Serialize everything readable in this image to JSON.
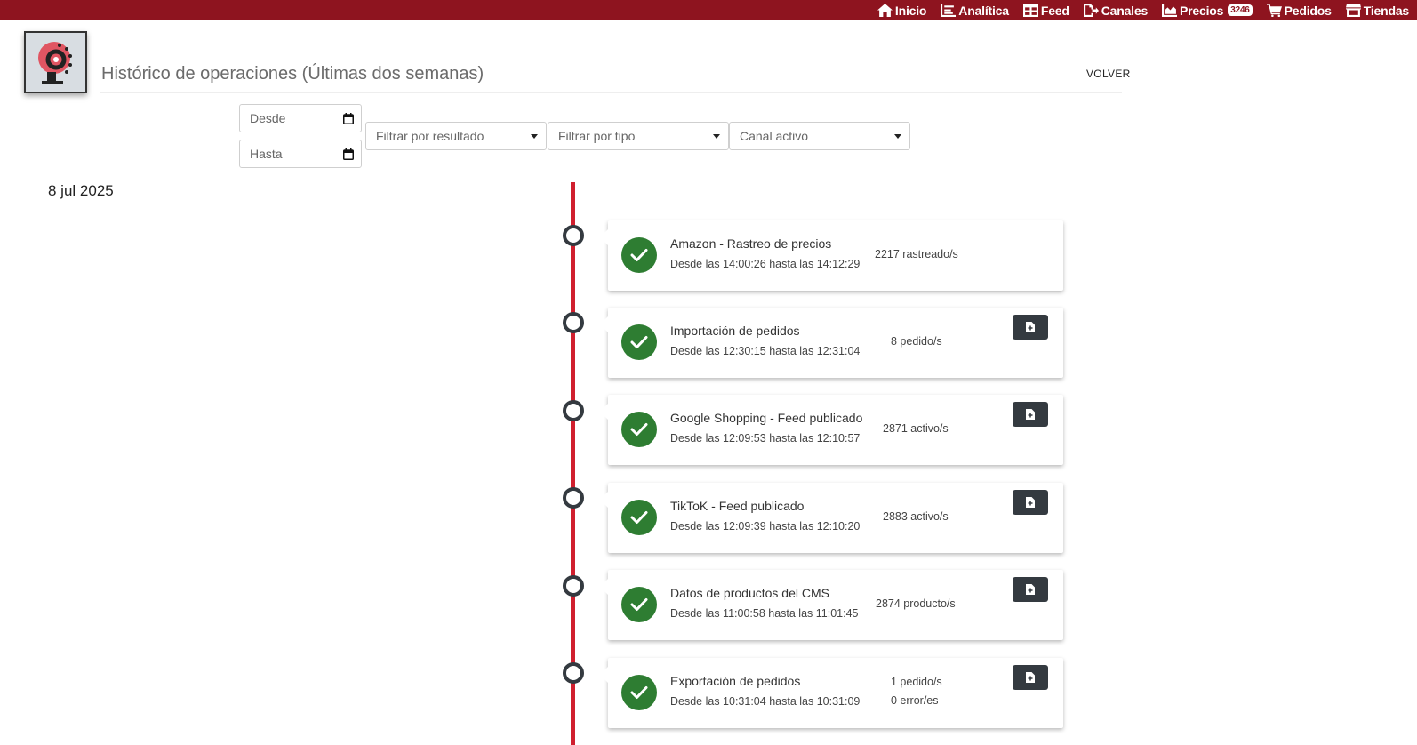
{
  "nav": {
    "items": [
      {
        "label": "Inicio",
        "icon": "home-icon"
      },
      {
        "label": "Analítica",
        "icon": "analytics-icon"
      },
      {
        "label": "Feed",
        "icon": "table-icon"
      },
      {
        "label": "Canales",
        "icon": "export-file-icon"
      },
      {
        "label": "Precios",
        "icon": "area-chart-icon",
        "badge": "3246"
      },
      {
        "label": "Pedidos",
        "icon": "cart-icon"
      },
      {
        "label": "Tiendas",
        "icon": "store-icon"
      }
    ]
  },
  "header": {
    "title": "Histórico de operaciones (Últimas dos semanas)",
    "back_label": "VOLVER"
  },
  "filters": {
    "from_placeholder": "Desde",
    "to_placeholder": "Hasta",
    "result_select": "Filtrar por resultado",
    "type_select": "Filtrar por tipo",
    "channel_select": "Canal activo"
  },
  "date_group": "8 jul 2025",
  "operations": [
    {
      "title": "Amazon - Rastreo de precios",
      "time": "Desde las 14:00:26 hasta las 14:12:29",
      "count": "2217 rastreado/s",
      "status": "success"
    },
    {
      "title": "Importación de pedidos",
      "time": "Desde las 12:30:15 hasta las 12:31:04",
      "count": "8 pedido/s",
      "status": "success"
    },
    {
      "title": "Google Shopping - Feed publicado",
      "time": "Desde las 12:09:53 hasta las 12:10:57",
      "count": "2871 activo/s",
      "status": "success"
    },
    {
      "title": "TikToK - Feed publicado",
      "time": "Desde las 12:09:39 hasta las 12:10:20",
      "count": "2883 activo/s",
      "status": "success"
    },
    {
      "title": "Datos de productos del CMS",
      "time": "Desde las 11:00:58 hasta las 11:01:45",
      "count": "2874 producto/s",
      "status": "success"
    },
    {
      "title": "Exportación de pedidos",
      "time": "Desde las 10:31:04 hasta las 10:31:09",
      "count": "1 pedido/s",
      "count2": "0 error/es",
      "status": "success"
    }
  ],
  "colors": {
    "topbar": "#8e141f",
    "timeline": "#d01f2e",
    "success": "#2e7d32",
    "dark_button": "#343a40"
  }
}
